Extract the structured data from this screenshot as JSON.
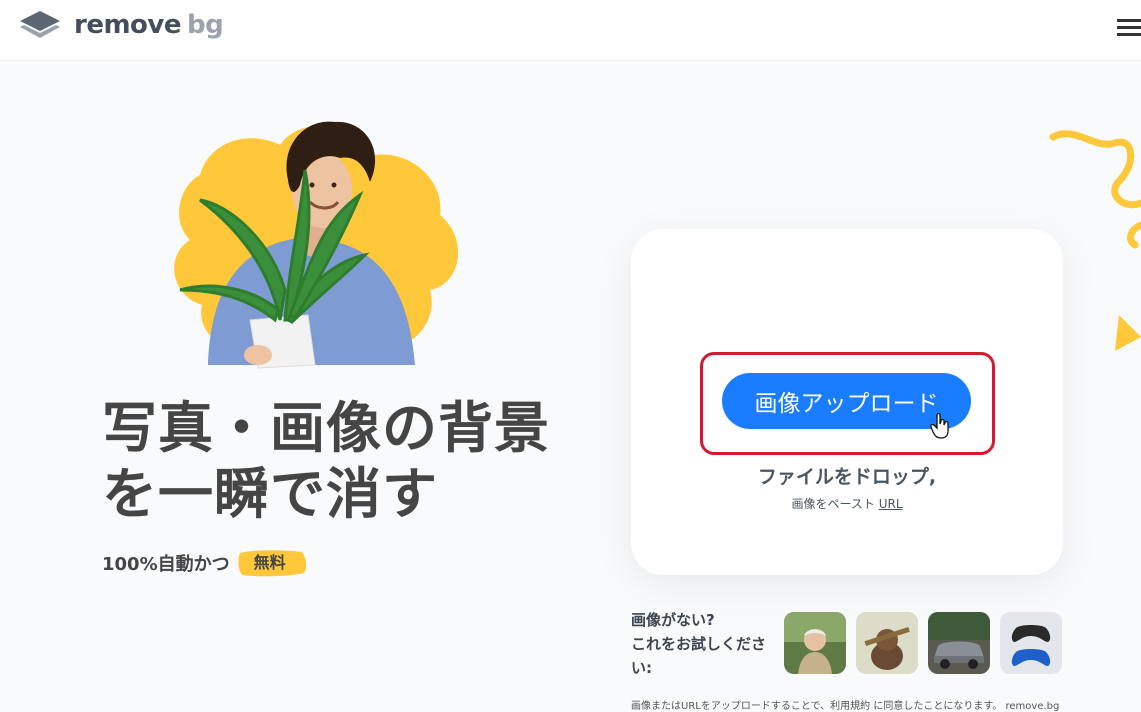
{
  "header": {
    "logo_word_remove": "remove",
    "logo_word_bg": "bg",
    "logo_icon": "layers-icon",
    "menu_icon": "hamburger-menu-icon"
  },
  "hero": {
    "headline_line1": "写真・画像の背景",
    "headline_line2": "を一瞬で消す",
    "subline": "100%自動かつ",
    "badge": "無料"
  },
  "upload": {
    "button_label": "画像アップロード",
    "drop_text": "ファイルをドロップ,",
    "paste_text": "画像をペースト",
    "url_link": "URL",
    "cursor_icon": "hand-pointer-icon"
  },
  "samples": {
    "label_line1": "画像がない?",
    "label_line2": "これをお試しくださ",
    "label_line3": "い:",
    "items": [
      "sample-person-icon",
      "sample-dog-icon",
      "sample-car-icon",
      "sample-gamepad-icon"
    ]
  },
  "footer": {
    "note": "画像またはURLをアップロードすることで、利用規約 に同意したことになります。 remove.bg"
  },
  "colors": {
    "accent": "#1a7cff",
    "highlight": "#d51a2e",
    "brand_yellow": "#ffc83a",
    "text": "#454545"
  }
}
